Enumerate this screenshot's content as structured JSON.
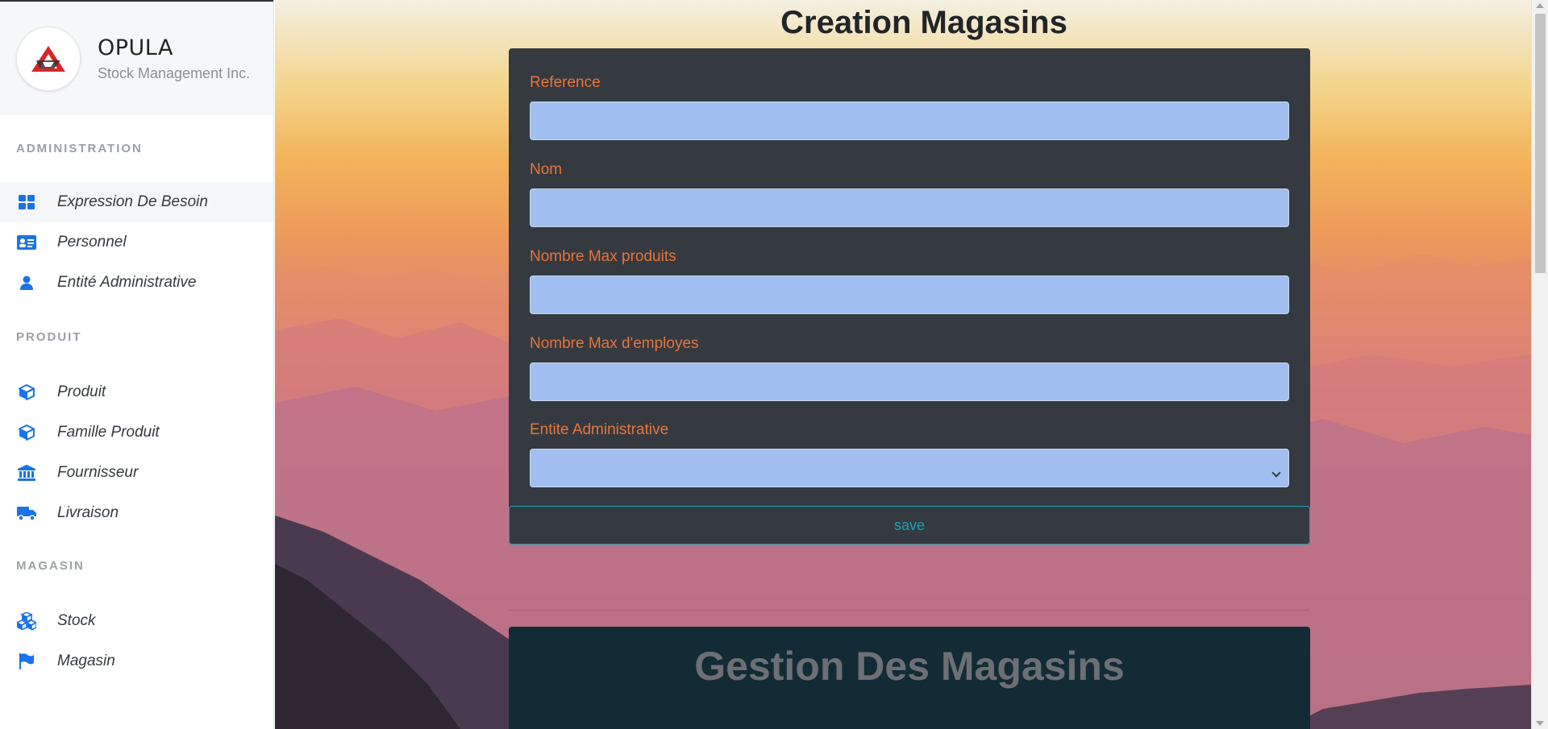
{
  "brand": {
    "title": "OPULA",
    "subtitle": "Stock Management Inc."
  },
  "sidebar": {
    "sections": [
      {
        "label": "ADMINISTRATION",
        "items": [
          {
            "label": "Expression De Besoin",
            "icon": "grid-icon"
          },
          {
            "label": "Personnel",
            "icon": "id-card-icon"
          },
          {
            "label": "Entité Administrative",
            "icon": "user-icon"
          }
        ]
      },
      {
        "label": "PRODUIT",
        "items": [
          {
            "label": "Produit",
            "icon": "box-icon"
          },
          {
            "label": "Famille Produit",
            "icon": "box-icon"
          },
          {
            "label": "Fournisseur",
            "icon": "bank-icon"
          },
          {
            "label": "Livraison",
            "icon": "truck-icon"
          }
        ]
      },
      {
        "label": "MAGASIN",
        "items": [
          {
            "label": "Stock",
            "icon": "boxes-icon"
          },
          {
            "label": "Magasin",
            "icon": "flag-icon"
          }
        ]
      }
    ]
  },
  "main": {
    "title": "Creation Magasins",
    "form": {
      "fields": [
        {
          "label": "Reference",
          "value": ""
        },
        {
          "label": "Nom",
          "value": ""
        },
        {
          "label": "Nombre Max produits",
          "value": ""
        },
        {
          "label": "Nombre Max d'employes",
          "value": ""
        },
        {
          "label": "Entite Administrative",
          "value": ""
        }
      ],
      "save_label": "save"
    },
    "gestion_title": "Gestion Des Magasins"
  },
  "colors": {
    "accent": "#e8743a",
    "icon_blue": "#1a73e8",
    "input_bg": "#a0bff0",
    "card_bg": "#343a40",
    "save_border": "#17a2b8",
    "gestion_bg": "#132b35"
  }
}
